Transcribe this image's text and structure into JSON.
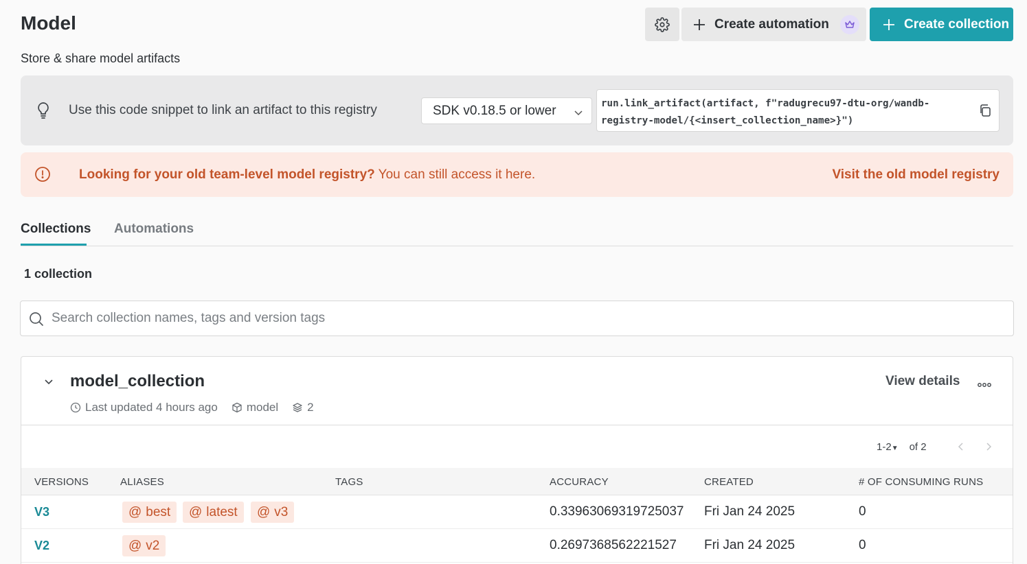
{
  "header": {
    "title": "Model",
    "subtitle": "Store & share model artifacts",
    "automation_button": "Create automation",
    "collection_button": "Create collection"
  },
  "snippet": {
    "text": "Use this code snippet to link an artifact to this registry",
    "sdk_selected": "SDK v0.18.5 or lower",
    "code": "run.link_artifact(artifact, f\"radugrecu97-dtu-org/wandb-\nregistry-model/{<insert_collection_name>}\")"
  },
  "warning": {
    "bold_text": "Looking for your old team-level model registry?",
    "text": " You can still access it here.",
    "link": "Visit the old model registry"
  },
  "tabs": [
    {
      "label": "Collections",
      "active": true
    },
    {
      "label": "Automations",
      "active": false
    }
  ],
  "count_text": "1 collection",
  "search": {
    "placeholder": "Search collection names, tags and version tags"
  },
  "collection": {
    "name": "model_collection",
    "last_updated": "Last updated 4 hours ago",
    "type": "model",
    "versions_count": "2",
    "view_details": "View details",
    "pager_range": "1-2",
    "pager_total": "of 2",
    "columns": [
      "VERSIONS",
      "ALIASES",
      "TAGS",
      "ACCURACY",
      "CREATED",
      "# OF CONSUMING RUNS"
    ],
    "rows": [
      {
        "version": "V3",
        "aliases": [
          "best",
          "latest",
          "v3"
        ],
        "tags": "",
        "accuracy": "0.33963069319725037",
        "created": "Fri Jan 24 2025",
        "consuming_runs": "0"
      },
      {
        "version": "V2",
        "aliases": [
          "v2"
        ],
        "tags": "",
        "accuracy": "0.2697368562221527",
        "created": "Fri Jan 24 2025",
        "consuming_runs": "0"
      }
    ]
  },
  "colors": {
    "accent": "#1ea0ad",
    "warning": "#c3542a",
    "warning_bg": "#fdeae4",
    "premium": "#7b5cd6"
  }
}
